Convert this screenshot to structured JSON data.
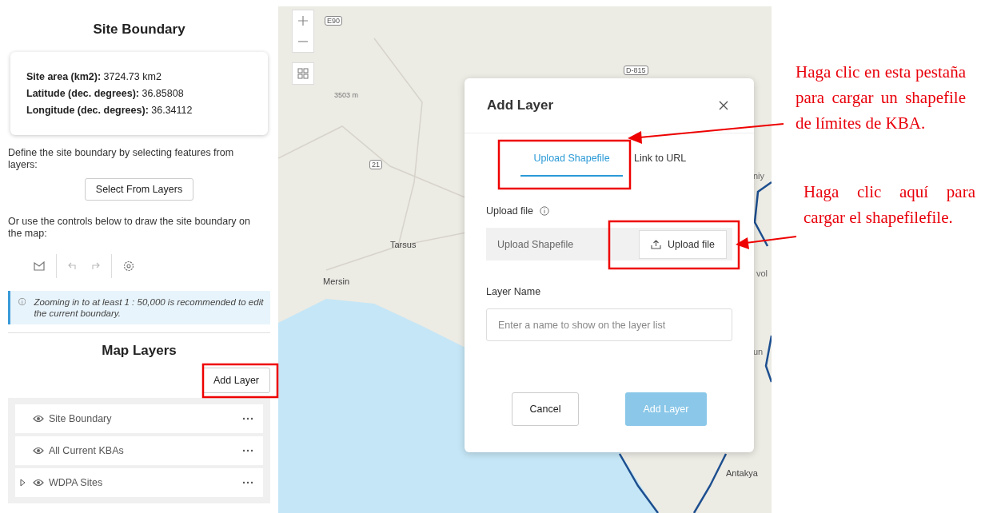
{
  "site_boundary": {
    "title": "Site Boundary",
    "stats": [
      {
        "label": "Site area (km2):",
        "value": "3724.73 km2"
      },
      {
        "label": "Latitude (dec. degrees):",
        "value": "36.85808"
      },
      {
        "label": "Longitude (dec. degrees):",
        "value": "36.34112"
      }
    ],
    "select_prompt": "Define the site boundary by selecting features from layers:",
    "select_button": "Select From Layers",
    "draw_prompt": "Or use the controls below to draw the site boundary on the map:",
    "notice": "Zooming in to at least 1 : 50,000 is recommended to edit the current boundary."
  },
  "map_layers": {
    "title": "Map Layers",
    "add_button": "Add Layer",
    "layers": [
      {
        "name": "Site Boundary",
        "expandable": false
      },
      {
        "name": "All Current KBAs",
        "expandable": false
      },
      {
        "name": "WDPA Sites",
        "expandable": true
      }
    ]
  },
  "map": {
    "labels": [
      {
        "text": "E90",
        "kind": "road"
      },
      {
        "text": "D-815",
        "kind": "road"
      },
      {
        "text": "3503 m",
        "kind": "peak"
      },
      {
        "text": "21",
        "kind": "road"
      },
      {
        "text": "Tarsus",
        "kind": "city"
      },
      {
        "text": "Mersin",
        "kind": "city"
      },
      {
        "text": "Antakya",
        "kind": "city"
      },
      {
        "text": "niy",
        "kind": "place"
      },
      {
        "text": "vol",
        "kind": "place"
      },
      {
        "text": "un",
        "kind": "place"
      }
    ]
  },
  "dialog": {
    "title": "Add Layer",
    "tabs": [
      {
        "label": "Upload Shapefile",
        "selected": true
      },
      {
        "label": "Link to URL",
        "selected": false
      }
    ],
    "upload_label": "Upload file",
    "upload_placeholder": "Upload Shapefile",
    "upload_button": "Upload file",
    "layer_name_label": "Layer Name",
    "layer_name_placeholder": "Enter a name to show on the layer list",
    "buttons": [
      {
        "label": "Cancel",
        "kind": "secondary",
        "disabled": false
      },
      {
        "label": "Add Layer",
        "kind": "primary",
        "disabled": true
      }
    ]
  },
  "annotations": [
    {
      "text": "Haga clic en esta pestaña para cargar un shapefile de límites de KBA."
    },
    {
      "text": "Haga clic aquí para cargar el shapefilefile."
    }
  ]
}
